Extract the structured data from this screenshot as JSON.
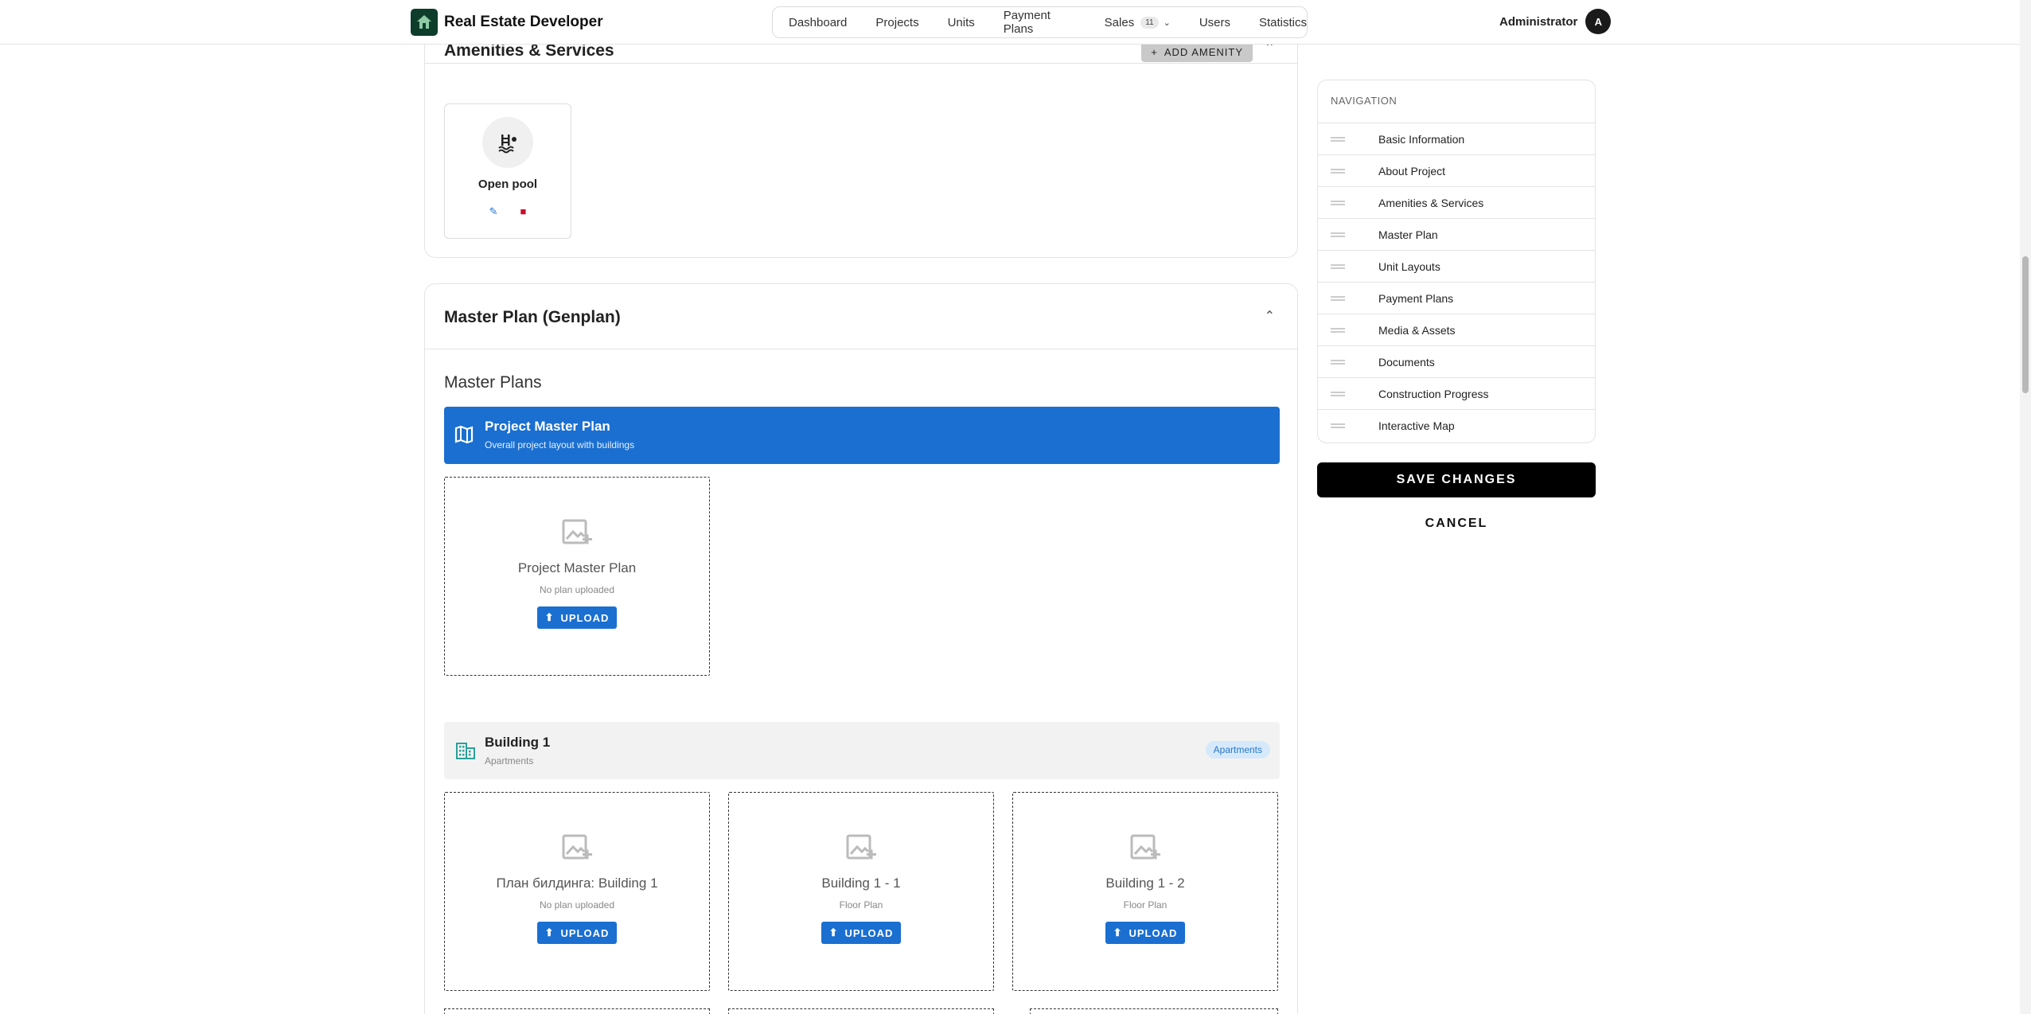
{
  "brand": {
    "name": "Real Estate Developer"
  },
  "nav": {
    "items": [
      "Dashboard",
      "Projects",
      "Units",
      "Payment Plans"
    ],
    "sales_label": "Sales",
    "sales_count": "11",
    "users": "Users",
    "statistics": "Statistics"
  },
  "user": {
    "name": "Administrator",
    "initial": "A"
  },
  "amenities": {
    "title": "Amenities & Services",
    "add_button": "ADD AMENITY",
    "items": [
      {
        "name": "Open pool",
        "icon": "pool-icon"
      }
    ]
  },
  "master_plan": {
    "title": "Master Plan (Genplan)",
    "subheading": "Master Plans",
    "banner": {
      "title": "Project Master Plan",
      "subtitle": "Overall project layout with buildings"
    },
    "project_plan": {
      "title": "Project Master Plan",
      "status": "No plan uploaded",
      "upload": "UPLOAD"
    },
    "building": {
      "title": "Building 1",
      "subtitle": "Apartments",
      "badge": "Apartments",
      "plans": [
        {
          "title": "План билдинга: Building 1",
          "sub": "No plan uploaded",
          "upload": "UPLOAD"
        },
        {
          "title": "Building 1 - 1",
          "sub": "Floor Plan",
          "upload": "UPLOAD"
        },
        {
          "title": "Building 1 - 2",
          "sub": "Floor Plan",
          "upload": "UPLOAD"
        }
      ]
    }
  },
  "sidenav": {
    "title": "NAVIGATION",
    "items": [
      "Basic Information",
      "About Project",
      "Amenities & Services",
      "Master Plan",
      "Unit Layouts",
      "Payment Plans",
      "Media & Assets",
      "Documents",
      "Construction Progress",
      "Interactive Map"
    ]
  },
  "actions": {
    "save": "SAVE CHANGES",
    "cancel": "CANCEL"
  },
  "colors": {
    "primary": "#1a6fd0",
    "brand_dark": "#0f3d2b",
    "badge_bg": "#d6e9fb"
  }
}
